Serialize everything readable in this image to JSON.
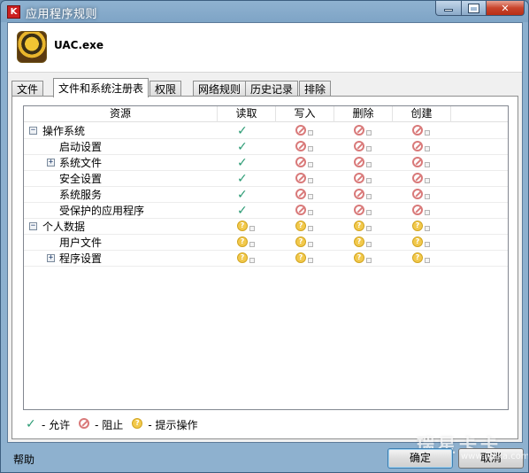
{
  "window": {
    "title": "应用程序规则",
    "logo_letter": "K",
    "controls": {
      "minimize": "minimize",
      "maximize": "maximize",
      "close": "✕"
    }
  },
  "app": {
    "name": "UAC.exe",
    "icon": "application-exe-icon"
  },
  "tabs": [
    {
      "label": "文件"
    },
    {
      "label": "文件和系统注册表",
      "active": true
    },
    {
      "label": "权限"
    },
    {
      "label": "网络规则"
    },
    {
      "label": "历史记录"
    },
    {
      "label": "排除"
    }
  ],
  "tree": {
    "columns": [
      "资源",
      "读取",
      "写入",
      "删除",
      "创建"
    ],
    "rows": [
      {
        "label": "操作系统",
        "toggle": "−",
        "read": "allow",
        "write": "block",
        "delete": "block",
        "create": "block"
      },
      {
        "label": "启动设置",
        "read": "allow",
        "write": "block",
        "delete": "block",
        "create": "block"
      },
      {
        "label": "系统文件",
        "toggle": "+",
        "read": "allow",
        "write": "block",
        "delete": "block",
        "create": "block"
      },
      {
        "label": "安全设置",
        "read": "allow",
        "write": "block",
        "delete": "block",
        "create": "block"
      },
      {
        "label": "系统服务",
        "read": "allow",
        "write": "block",
        "delete": "block",
        "create": "block"
      },
      {
        "label": "受保护的应用程序",
        "read": "allow",
        "write": "block",
        "delete": "block",
        "create": "block"
      },
      {
        "label": "个人数据",
        "toggle": "−",
        "read": "ask",
        "write": "ask",
        "delete": "ask",
        "create": "ask"
      },
      {
        "label": "用户文件",
        "read": "ask",
        "write": "ask",
        "delete": "ask",
        "create": "ask"
      },
      {
        "label": "程序设置",
        "toggle": "+",
        "read": "ask",
        "write": "ask",
        "delete": "ask",
        "create": "ask"
      }
    ]
  },
  "legend": {
    "allow": "- 允许",
    "block": "- 阻止",
    "ask": "- 提示操作"
  },
  "footer": {
    "help": "帮助",
    "ok": "确定",
    "cancel": "取消"
  },
  "watermark": {
    "text": "瑞星卡卡",
    "url": "www.ikaka.com"
  },
  "colors": {
    "allow": "#2b9b74",
    "block": "#d97a7a",
    "ask": "#f2c94c",
    "titlebar": "#7ea4c6"
  }
}
